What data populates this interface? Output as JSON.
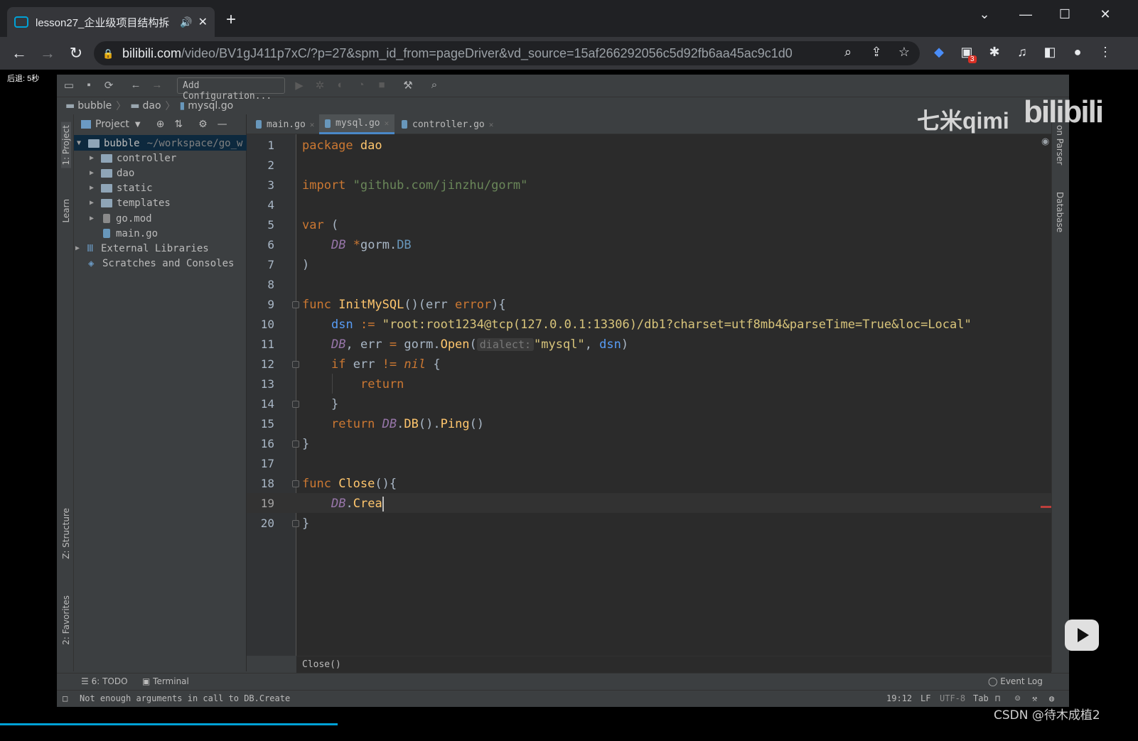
{
  "browser": {
    "tab_title": "lesson27_企业级项目结构拆",
    "url_host": "bilibili.com",
    "url_path": "/video/BV1gJ411p7xC/?p=27&spm_id_from=pageDriver&vd_source=15af266292056c5d92fb6aa45ac9c1d0",
    "extension_badge": "3"
  },
  "overlay": {
    "seek_hint": "后退: 5秒"
  },
  "ide": {
    "toolbar": {
      "run_config": "Add Configuration..."
    },
    "breadcrumb": [
      "bubble",
      "dao",
      "mysql.go"
    ],
    "project": {
      "title": "Project",
      "tree": [
        {
          "name": "bubble",
          "hint": "~/workspace/go_w",
          "level": 0,
          "type": "folder",
          "expanded": true
        },
        {
          "name": "controller",
          "level": 1,
          "type": "folder"
        },
        {
          "name": "dao",
          "level": 1,
          "type": "folder"
        },
        {
          "name": "static",
          "level": 1,
          "type": "folder"
        },
        {
          "name": "templates",
          "level": 1,
          "type": "folder"
        },
        {
          "name": "go.mod",
          "level": 1,
          "type": "file"
        },
        {
          "name": "main.go",
          "level": 1,
          "type": "gofile"
        },
        {
          "name": "External Libraries",
          "level": 0,
          "type": "lib"
        },
        {
          "name": "Scratches and Consoles",
          "level": 0,
          "type": "scratch"
        }
      ]
    },
    "left_tabs": [
      "1: Project",
      "Learn",
      "Z: Structure",
      "2: Favorites"
    ],
    "right_tabs": [
      "on Parser",
      "Database"
    ],
    "editor_tabs": [
      {
        "label": "main.go",
        "active": false
      },
      {
        "label": "mysql.go",
        "active": true
      },
      {
        "label": "controller.go",
        "active": false
      }
    ],
    "line_numbers": [
      "1",
      "2",
      "3",
      "4",
      "5",
      "6",
      "7",
      "8",
      "9",
      "10",
      "11",
      "12",
      "13",
      "14",
      "15",
      "16",
      "17",
      "18",
      "19",
      "20"
    ],
    "code": {
      "l1_kw": "package",
      "l1_name": "dao",
      "l3_kw": "import",
      "l3_str": "\"github.com/jinzhu/gorm\"",
      "l5_kw": "var",
      "l5_paren": "(",
      "l6_db": "DB",
      "l6_star": "*",
      "l6_pkg": "gorm",
      "l6_dot": ".",
      "l6_type": "DB",
      "l7": ")",
      "l9_kw": "func",
      "l9_fn": "InitMySQL",
      "l9_p1": "()(err ",
      "l9_ty": "error",
      "l9_p2": "){",
      "l10_var": "dsn",
      "l10_op": ":=",
      "l10_str": "\"root:root1234@tcp(127.0.0.1:13306)/db1?charset=utf8mb4&parseTime=True&loc=Local\"",
      "l11_db": "DB",
      "l11_mid": ", err ",
      "l11_eq": "=",
      "l11_pkg": " gorm.",
      "l11_fn": "Open",
      "l11_open": "(",
      "l11_hint": "dialect:",
      "l11_str": "\"mysql\"",
      "l11_sep": ", ",
      "l11_var": "dsn",
      "l11_close": ")",
      "l12_kw": "if",
      "l12_mid": " err ",
      "l12_op": "!=",
      "l12_nil": "nil",
      "l12_end": " {",
      "l13_kw": "return",
      "l14": "}",
      "l15_kw": "return",
      "l15_db": "DB",
      "l15_dot": ".",
      "l15_m1": "DB",
      "l15_p": "().",
      "l15_m2": "Ping",
      "l15_end": "()",
      "l16": "}",
      "l18_kw": "func",
      "l18_fn": "Close",
      "l18_end": "(){",
      "l19_db": "DB",
      "l19_dot": ".",
      "l19_typed": "Crea",
      "l20": "}"
    },
    "editor_crumb": "Close()",
    "bottom_tools": {
      "todo": "6: TODO",
      "terminal": "Terminal",
      "event_log": "Event Log"
    },
    "status": {
      "message": "Not enough arguments in call to DB.Create",
      "position": "19:12",
      "line_sep": "LF",
      "encoding": "UTF-8",
      "indent": "Tab"
    }
  },
  "watermarks": {
    "author": "七米qimi",
    "site": "bilibili",
    "csdn": "CSDN @待木成植2"
  },
  "colors": {
    "accent": "#00a1d6",
    "ide_bg": "#2b2b2b",
    "keyword": "#cc7832",
    "string": "#6a8759",
    "function": "#ffc66d"
  }
}
